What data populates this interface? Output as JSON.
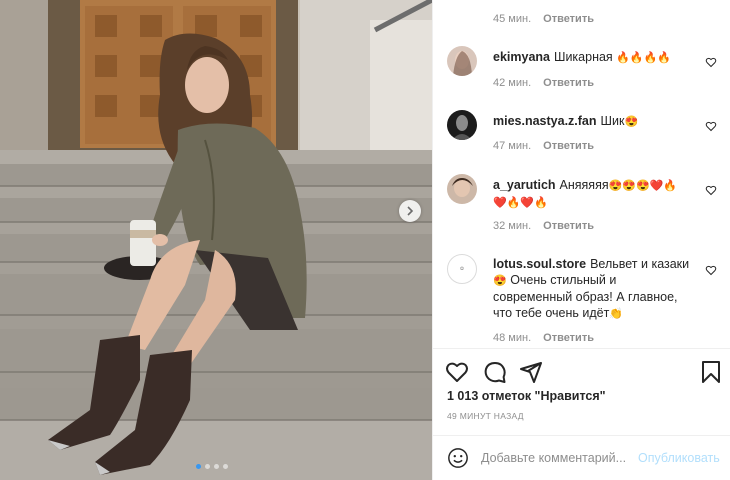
{
  "comments_top_meta": {
    "time": "45 мин.",
    "reply": "Ответить"
  },
  "comments": [
    {
      "username": "ekimyana",
      "text": "Шикарная",
      "emojis": "🔥🔥🔥🔥",
      "time": "42 мин.",
      "reply": "Ответить"
    },
    {
      "username": "mies.nastya.z.fan",
      "text": "Шик",
      "emojis": "😍",
      "time": "47 мин.",
      "reply": "Ответить"
    },
    {
      "username": "a_yarutich",
      "text": "Аняяяяя",
      "emojis": "😍😍😍❤️🔥",
      "emojis2": "❤️🔥❤️🔥",
      "time": "32 мин.",
      "reply": "Ответить"
    },
    {
      "username": "lotus.soul.store",
      "text": "Вельвет и казаки",
      "emojis": "😍",
      "text2": "Очень стильный и современный образ! А главное, что тебе очень идёт",
      "emojis_end": "👏",
      "time": "48 мин.",
      "reply": "Ответить"
    }
  ],
  "actions": {
    "likes": "1 013 отметок \"Нравится\"",
    "posted": "49 минут назад"
  },
  "add_comment": {
    "placeholder": "Добавьте комментарий...",
    "post_label": "Опубликовать"
  },
  "carousel": {
    "slides": 4,
    "active": 1
  },
  "colors": {
    "accent": "#3897f0",
    "post_disabled": "#b2dffc",
    "muted": "#8e8e8e"
  }
}
